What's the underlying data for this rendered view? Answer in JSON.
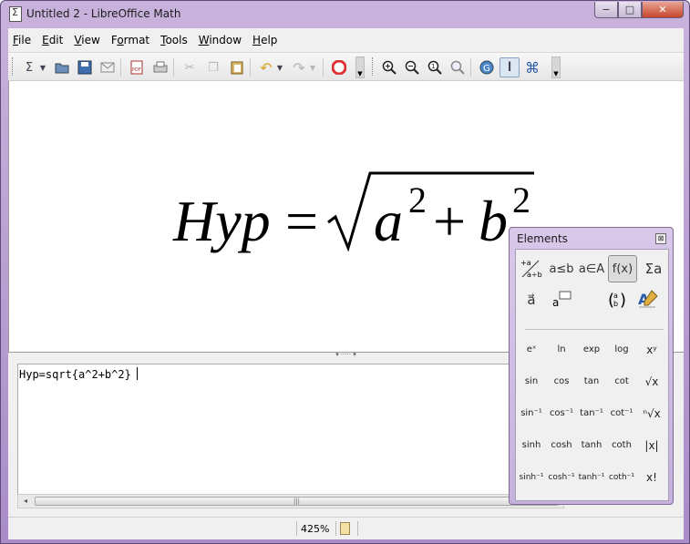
{
  "window": {
    "title": "Untitled 2 - LibreOffice Math"
  },
  "window_controls": {
    "minimize": "−",
    "maximize": "□",
    "close": "✕"
  },
  "menu": [
    {
      "label": "File",
      "underline": "F",
      "rest": "ile"
    },
    {
      "label": "Edit",
      "underline": "E",
      "rest": "dit"
    },
    {
      "label": "View",
      "underline": "V",
      "rest": "iew"
    },
    {
      "label": "Format",
      "underline": "F",
      "rest": "ormat",
      "prefix": "",
      "u_index": 1
    },
    {
      "label": "Tools",
      "underline": "T",
      "rest": "ools"
    },
    {
      "label": "Window",
      "underline": "W",
      "rest": "indow"
    },
    {
      "label": "Help",
      "underline": "H",
      "rest": "elp"
    }
  ],
  "toolbar": {
    "icons": [
      "new-formula-icon",
      "open-icon",
      "save-icon",
      "email-icon",
      "export-pdf-icon",
      "print-icon",
      "cut-icon",
      "copy-icon",
      "paste-icon",
      "undo-icon",
      "redo-icon",
      "help-icon",
      "zoom-in-icon",
      "zoom-out-icon",
      "zoom-100-icon",
      "show-all-icon",
      "update-icon",
      "formula-cursor-icon",
      "symbols-icon"
    ]
  },
  "formula": {
    "hyp": "Hyp",
    "eq": "=",
    "a": "a",
    "sup1": "2",
    "plus": "+",
    "b": "b",
    "sup2": "2"
  },
  "command": {
    "text": "Hyp=sqrt{a^2+b^2}"
  },
  "status": {
    "zoom": "425%"
  },
  "elements_panel": {
    "title": "Elements",
    "categories": [
      "unary-binary-operators-icon",
      "relations-icon",
      "set-operations-icon",
      "functions-icon",
      "operators-icon",
      "attributes-icon",
      "others-icon",
      "brackets-icon",
      "formats-icon"
    ],
    "category_labels": {
      "relations": "a≤b",
      "set": "a∈A",
      "functions": "f(x)",
      "operators": "Σa",
      "attributes": "a⃗",
      "brackets": "(a/b)"
    },
    "functions": [
      [
        "eˣ",
        "ln",
        "exp",
        "log",
        "xʸ"
      ],
      [
        "sin",
        "cos",
        "tan",
        "cot",
        "√x"
      ],
      [
        "sin⁻¹",
        "cos⁻¹",
        "tan⁻¹",
        "cot⁻¹",
        "ⁿ√x"
      ],
      [
        "sinh",
        "cosh",
        "tanh",
        "coth",
        "|x|"
      ],
      [
        "sinh⁻¹",
        "cosh⁻¹",
        "tanh⁻¹",
        "coth⁻¹",
        "x!"
      ]
    ]
  },
  "colors": {
    "title_bar": "#c2a9da",
    "accent": "#8aa3c0"
  }
}
